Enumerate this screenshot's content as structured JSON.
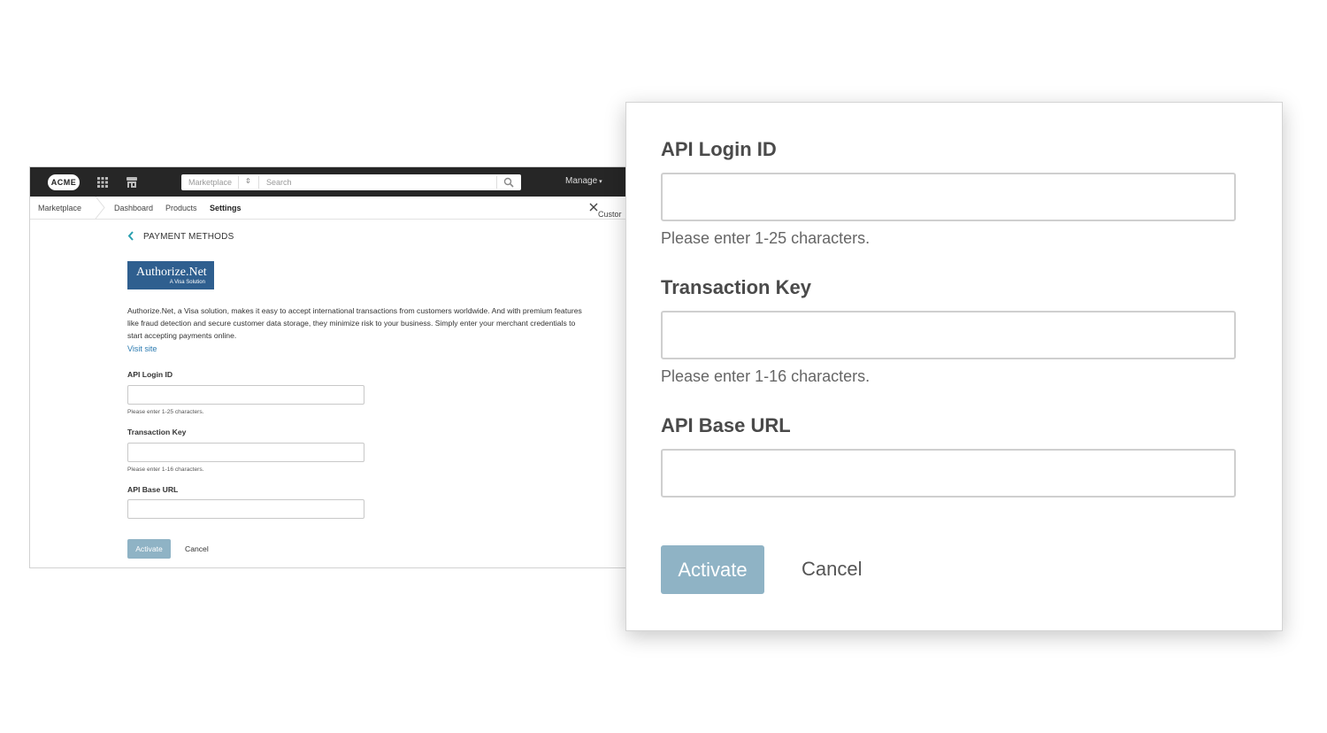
{
  "topbar": {
    "logo": "ACME",
    "search_scope": "Marketplace",
    "search_placeholder": "Search",
    "manage_label": "Manage"
  },
  "subnav": {
    "root": "Marketplace",
    "tabs": [
      "Dashboard",
      "Products",
      "Settings"
    ],
    "active_tab": "Settings",
    "tools_label": "Custor"
  },
  "page": {
    "title": "PAYMENT METHODS",
    "logo_name": "Authorize.Net",
    "logo_tagline": "A Visa Solution",
    "description": "Authorize.Net, a Visa solution, makes it easy to accept international transactions from customers worldwide. And with premium features like fraud detection and secure customer data storage, they minimize risk to your business. Simply enter your merchant credentials to start accepting payments online.",
    "visit_link": "Visit site"
  },
  "form": {
    "api_login_label": "API Login ID",
    "api_login_hint": "Please enter 1-25 characters.",
    "api_login_value": "",
    "transaction_key_label": "Transaction Key",
    "transaction_key_hint": "Please enter 1-16 characters.",
    "transaction_key_value": "",
    "api_base_url_label": "API Base URL",
    "api_base_url_value": "",
    "activate_label": "Activate",
    "cancel_label": "Cancel"
  },
  "colors": {
    "topbar": "#262626",
    "activate_button": "#8fb3c5",
    "link": "#2a7ab0",
    "authorize_logo": "#2f5f8f",
    "back_chevron": "#2a9fb0"
  }
}
